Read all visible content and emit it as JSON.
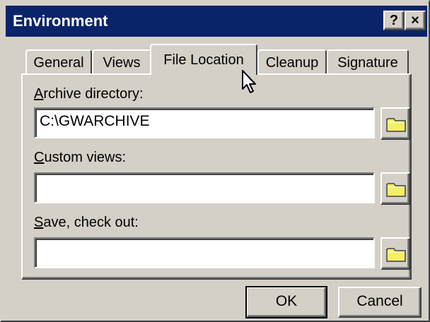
{
  "window": {
    "title": "Environment",
    "help_glyph": "?",
    "close_glyph": "×"
  },
  "tabs": [
    {
      "label": "General",
      "active": false
    },
    {
      "label": "Views",
      "active": false
    },
    {
      "label": "File Location",
      "active": true
    },
    {
      "label": "Cleanup",
      "active": false
    },
    {
      "label": "Signature",
      "active": false
    }
  ],
  "fields": {
    "archive": {
      "accel": "A",
      "label_rest": "rchive directory:",
      "value": ""
    },
    "custom": {
      "accel": "C",
      "label_rest": "ustom views:",
      "value": ""
    },
    "save": {
      "accel": "S",
      "label_rest": "ave, check out:",
      "value": ""
    }
  },
  "archive_value": "C:\\GWARCHIVE",
  "buttons": {
    "ok": "OK",
    "cancel": "Cancel"
  },
  "icons": {
    "browse": "folder-icon"
  },
  "colors": {
    "titlebar": "#0a246a",
    "face": "#d4d0c8",
    "folder": "#f2f064"
  }
}
